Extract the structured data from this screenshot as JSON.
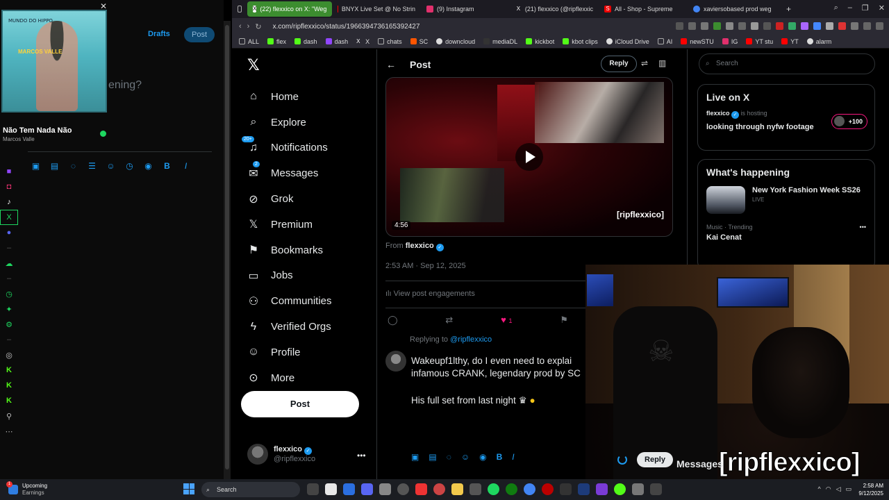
{
  "music": {
    "album_text": "MUNDO DO HIPPO",
    "album_title": "MARCOS VALLE",
    "song_title": "Não Tem Nada Não",
    "artist": "Marcos Valle"
  },
  "composer": {
    "drafts": "Drafts",
    "post": "Post",
    "placeholder": "ening?"
  },
  "browser": {
    "tabs": [
      {
        "label": "(22) flexxico on X: \"Weg",
        "active": true
      },
      {
        "label": "BNYX Live Set @ No Strin"
      },
      {
        "label": "(9) Instagram"
      },
      {
        "label": "(21) flexxico (@ripflexxic"
      },
      {
        "label": "All - Shop - Supreme"
      },
      {
        "label": "xaviersobased prod weg"
      }
    ],
    "url": "x.com/ripflexxico/status/1966394736165392427",
    "bookmarks": [
      "ALL",
      "flex",
      "dash",
      "dash",
      "X",
      "chats",
      "SC",
      "downcloud",
      "mediaDL",
      "kickbot",
      "kbot clips",
      "iCloud Drive",
      "AI",
      "newSTU",
      "IG",
      "YT stu",
      "YT",
      "alarm"
    ]
  },
  "nav": {
    "items": [
      {
        "label": "Home",
        "icon": "home-icon"
      },
      {
        "label": "Explore",
        "icon": "search-icon"
      },
      {
        "label": "Notifications",
        "icon": "bell-icon",
        "badge": "20+"
      },
      {
        "label": "Messages",
        "icon": "mail-icon",
        "badge": "2"
      },
      {
        "label": "Grok",
        "icon": "grok-icon"
      },
      {
        "label": "Premium",
        "icon": "x-icon"
      },
      {
        "label": "Bookmarks",
        "icon": "bookmark-icon"
      },
      {
        "label": "Jobs",
        "icon": "briefcase-icon"
      },
      {
        "label": "Communities",
        "icon": "people-icon"
      },
      {
        "label": "Verified Orgs",
        "icon": "lightning-icon"
      },
      {
        "label": "Profile",
        "icon": "person-icon"
      },
      {
        "label": "More",
        "icon": "more-circle-icon"
      }
    ],
    "post_button": "Post",
    "account_name": "flexxico",
    "account_handle": "@ripflexxico"
  },
  "post": {
    "header_title": "Post",
    "reply_button": "Reply",
    "video_duration": "4:56",
    "video_watermark": "[ripflexxico]",
    "from_prefix": "From",
    "from_name": "flexxico",
    "timestamp": "2:53 AM · Sep 12, 2025",
    "engagements": "View post engagements",
    "like_count": "1",
    "replying_prefix": "Replying to",
    "replying_to": "@ripflexxico",
    "reply_line1": "Wakeupf1lthy, do I even need to explai",
    "reply_line2": "infamous CRANK, legendary prod by SC",
    "reply_line3": "His full set from last night"
  },
  "sidebar": {
    "search_placeholder": "Search",
    "live_heading": "Live on X",
    "live_host": "flexxico",
    "live_hosting": "is hosting",
    "live_title": "looking through nyfw footage",
    "live_count": "+100",
    "happening_heading": "What's happening",
    "trend1_title": "New York Fashion Week SS26",
    "trend1_status": "LIVE",
    "trend2_category": "Music · Trending",
    "trend2_name": "Kai Cenat"
  },
  "overlay": {
    "watermark": "[ripflexxico]",
    "reply_button": "Reply",
    "messages": "Messages"
  },
  "taskbar": {
    "weather_badge": "1",
    "weather_line1": "Upcoming",
    "weather_line2": "Earnings",
    "search": "Search",
    "time": "2:58 AM",
    "date": "9/12/2025"
  }
}
